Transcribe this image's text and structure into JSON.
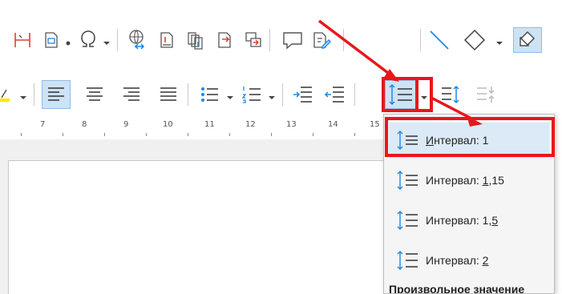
{
  "ruler": {
    "numbers": [
      "7",
      "8",
      "9",
      "10",
      "11",
      "12",
      "13",
      "14",
      "15"
    ]
  },
  "line_spacing_menu": {
    "items": [
      {
        "label_before": "",
        "accel": "И",
        "label_after": "нтервал: 1",
        "selected": true
      },
      {
        "label_before": "Интервал: ",
        "accel": "1",
        "label_after": ",15",
        "selected": false
      },
      {
        "label_before": "Интервал: 1,",
        "accel": "5",
        "label_after": "",
        "selected": false
      },
      {
        "label_before": "Интервал: ",
        "accel": "2",
        "label_after": "",
        "selected": false
      }
    ],
    "footer": "Произвольное значение"
  },
  "colors": {
    "accent_blue": "#1e88e5",
    "highlight_red": "#e8171b",
    "selected_bg": "#dbeaf6",
    "toolbar_active_bg": "#cde3f5"
  },
  "icons": [
    "page-break-icon",
    "insert-field-icon",
    "special-character-icon",
    "hyperlink-icon",
    "footnote-icon",
    "endnote-icon",
    "bookmark-icon",
    "cross-reference-icon",
    "comment-icon",
    "track-changes-icon",
    "line-icon",
    "basic-shapes-icon",
    "draw-functions-icon",
    "highlight-color-icon",
    "align-left-icon",
    "align-center-icon",
    "align-right-icon",
    "justify-icon",
    "unordered-list-icon",
    "ordered-list-icon",
    "increase-indent-icon",
    "decrease-indent-icon",
    "line-spacing-icon",
    "increase-paragraph-spacing-icon",
    "decrease-paragraph-spacing-icon"
  ]
}
